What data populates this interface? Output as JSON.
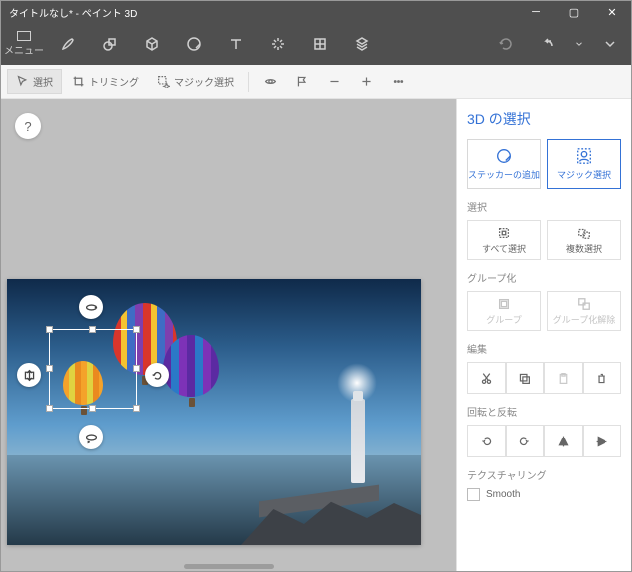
{
  "titlebar": {
    "title": "タイトルなし* - ペイント 3D"
  },
  "topbar": {
    "menu_label": "メニュー"
  },
  "ribbon": {
    "select": "選択",
    "trimming": "トリミング",
    "magic_select": "マジック選択"
  },
  "sidepanel": {
    "title": "3D の選択",
    "sticker_add": "ステッカーの追加",
    "magic_select": "マジック選択",
    "section_select": "選択",
    "select_all": "すべて選択",
    "multi_select": "複数選択",
    "section_group": "グループ化",
    "group": "グループ",
    "ungroup": "グループ化解除",
    "section_edit": "編集",
    "section_rotate": "回転と反転",
    "section_texture": "テクスチャリング",
    "smooth": "Smooth"
  },
  "help": {
    "label": "?"
  }
}
